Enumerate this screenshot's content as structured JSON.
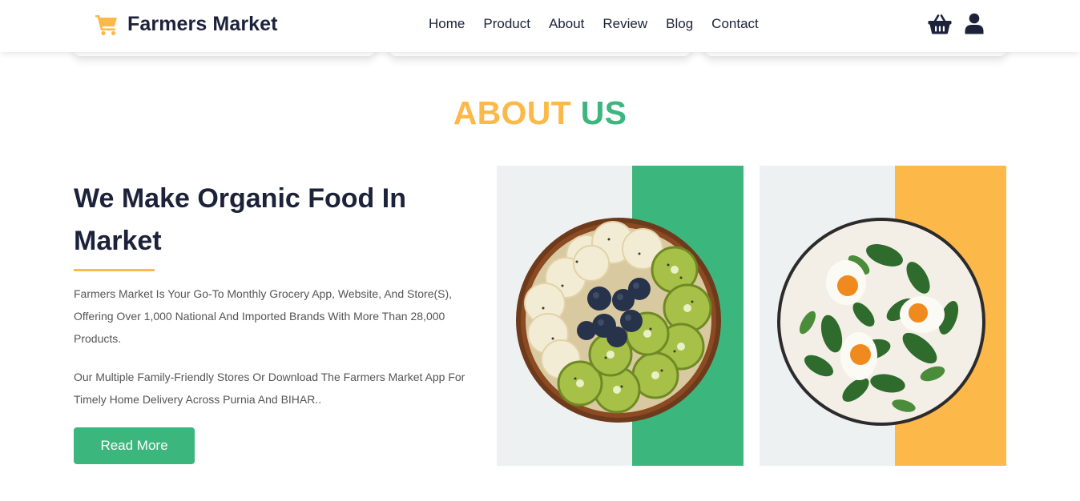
{
  "header": {
    "brand": "Farmers Market",
    "brand_icon": "shopping-cart-icon",
    "nav": [
      "Home",
      "Product",
      "About",
      "Review",
      "Blog",
      "Contact"
    ],
    "basket_icon": "basket-icon",
    "user_icon": "user-icon"
  },
  "about": {
    "title_part1": "ABOUT",
    "title_part2": "US",
    "headline": "We Make Organic Food In Market",
    "paragraph1": "Farmers Market Is Your Go-To Monthly Grocery App, Website, And Store(S), Offering Over 1,000 National And Imported Brands With More Than 28,000 Products.",
    "paragraph2": "Our Multiple Family-Friendly Stores Or Download The Farmers Market App For Timely Home Delivery Across Purnia And BIHAR..",
    "button_label": "Read More",
    "images": [
      {
        "name": "fruit-bowl-image",
        "band_color": "#3bb77e"
      },
      {
        "name": "salad-bowl-image",
        "band_color": "#fdb84a"
      }
    ]
  },
  "colors": {
    "accent_yellow": "#fdb84a",
    "accent_green": "#3bb77e",
    "text_dark": "#1c2239",
    "panel_bg": "#eef1f2"
  }
}
